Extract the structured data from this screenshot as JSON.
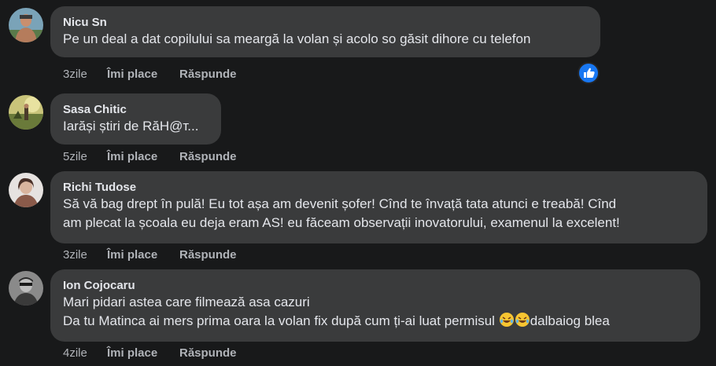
{
  "comments": [
    {
      "author": "Nicu Sn",
      "lines": [
        "Pe un deal a dat copilului sa meargă la volan și acolo so găsit dihore cu telefon"
      ],
      "time": "3zile",
      "like_label": "Îmi place",
      "reply_label": "Răspunde",
      "reaction": "like-icon"
    },
    {
      "author": "Sasa Chitic",
      "lines": [
        "Iarăși știri de RăH@т..."
      ],
      "time": "5zile",
      "like_label": "Îmi place",
      "reply_label": "Răspunde"
    },
    {
      "author": "Richi Tudose",
      "lines": [
        "Să vă bag drept în pulă! Eu tot așa am devenit șofer! Cînd te învață tata atunci e treabă! Cînd",
        "am plecat la școala eu deja eram AS! eu făceam observații inovatorului, examenul la excelent!"
      ],
      "time": "3zile",
      "like_label": "Îmi place",
      "reply_label": "Răspunde"
    },
    {
      "author": "Ion Cojocaru",
      "lines": [
        "Mari pidari astea care filmează asa cazuri",
        "Da tu Matinca ai mers prima oara la volan fix după cum ți-ai luat permisul",
        "dalbaiog blea"
      ],
      "emoji": "rolling-laughing-emoji",
      "time": "4zile",
      "like_label": "Îmi place",
      "reply_label": "Răspunde"
    }
  ],
  "colors": {
    "background": "#18191a",
    "bubble": "#3a3b3c",
    "text": "#e4e6eb",
    "secondary": "#b0b3b8",
    "accent": "#1877f2"
  }
}
